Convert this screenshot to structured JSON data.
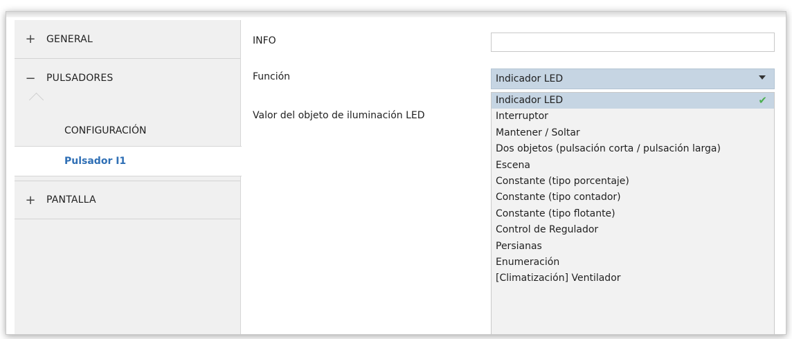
{
  "sidebar": {
    "general": {
      "sign": "+",
      "label": "GENERAL"
    },
    "pulsadores": {
      "sign": "−",
      "label": "PULSADORES"
    },
    "configuracion": {
      "label": "CONFIGURACIÓN"
    },
    "pulsador_i1": {
      "label": "Pulsador I1"
    },
    "pantalla": {
      "sign": "+",
      "label": "PANTALLA"
    }
  },
  "main": {
    "info_label": "INFO",
    "info_value": "",
    "funcion_label": "Función",
    "funcion_value": "Indicador LED",
    "valor_label": "Valor del objeto de iluminación LED"
  },
  "dropdown": {
    "options": [
      "Indicador LED",
      "Interruptor",
      "Mantener / Soltar",
      "Dos objetos (pulsación corta / pulsación larga)",
      "Escena",
      "Constante (tipo porcentaje)",
      "Constante (tipo contador)",
      "Constante (tipo flotante)",
      "Control de Regulador",
      "Persianas",
      "Enumeración",
      "[Climatización] Ventilador"
    ],
    "selected_index": 0,
    "check_glyph": "✔"
  },
  "colors": {
    "selection": "#c6d5e3",
    "active_link": "#2f6fb5",
    "check": "#4caf50"
  }
}
